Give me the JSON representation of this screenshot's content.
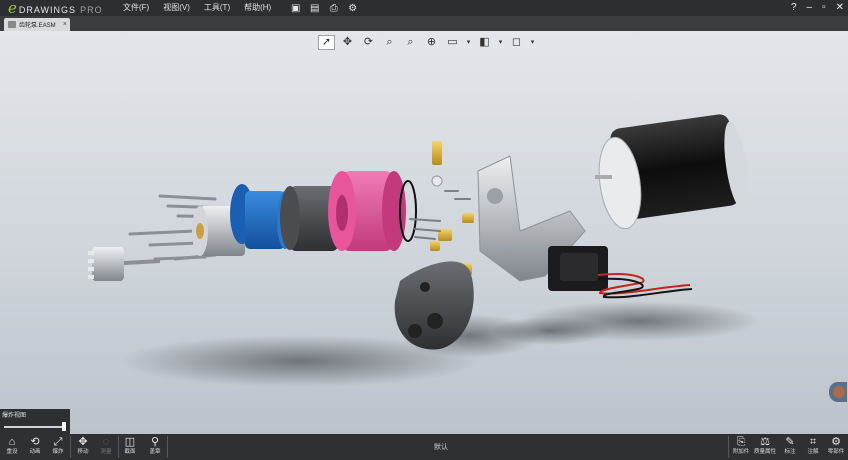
{
  "app": {
    "logo_e": "e",
    "logo_word": "DRAWINGS",
    "logo_edition": "PRO"
  },
  "menu": [
    "文件(F)",
    "视图(V)",
    "工具(T)",
    "帮助(H)"
  ],
  "titlebar_icons": [
    "open-icon",
    "save-icon",
    "print-icon",
    "settings-icon"
  ],
  "window_controls": {
    "help": "?",
    "minimize": "–",
    "restore": "▫",
    "close": "✕"
  },
  "tab": {
    "label": "齿轮泵.EASM",
    "close": "×"
  },
  "view_tools": [
    "select-icon",
    "pan-icon",
    "rotate-icon",
    "zoom-area-icon",
    "zoom-icon",
    "zoom-fit-icon",
    "display-style-icon",
    "view-orientation-icon",
    "section-icon"
  ],
  "left_panel": {
    "label": "爆炸视图",
    "slider_level": 1.0
  },
  "bottom_left": [
    {
      "name": "home",
      "label": "重设"
    },
    {
      "name": "animate",
      "label": "动画"
    },
    {
      "name": "explode",
      "label": "爆炸"
    },
    {
      "name": "move",
      "label": "移动"
    },
    {
      "name": "measure",
      "label": "测量",
      "disabled": true
    },
    {
      "name": "section",
      "label": "截面"
    },
    {
      "name": "stamp",
      "label": "盖章"
    }
  ],
  "bottom_status": "默认",
  "bottom_right": [
    {
      "name": "attachments",
      "label": "附加件"
    },
    {
      "name": "mass-properties",
      "label": "质量属性"
    },
    {
      "name": "markup",
      "label": "标注"
    },
    {
      "name": "explode-lines",
      "label": "注解"
    },
    {
      "name": "components",
      "label": "零部件"
    }
  ],
  "colors": {
    "accent_green": "#9bc53d",
    "bar_bg": "#2c2e31",
    "pink_part": "#e8559a",
    "blue_part": "#1f6fc2"
  }
}
